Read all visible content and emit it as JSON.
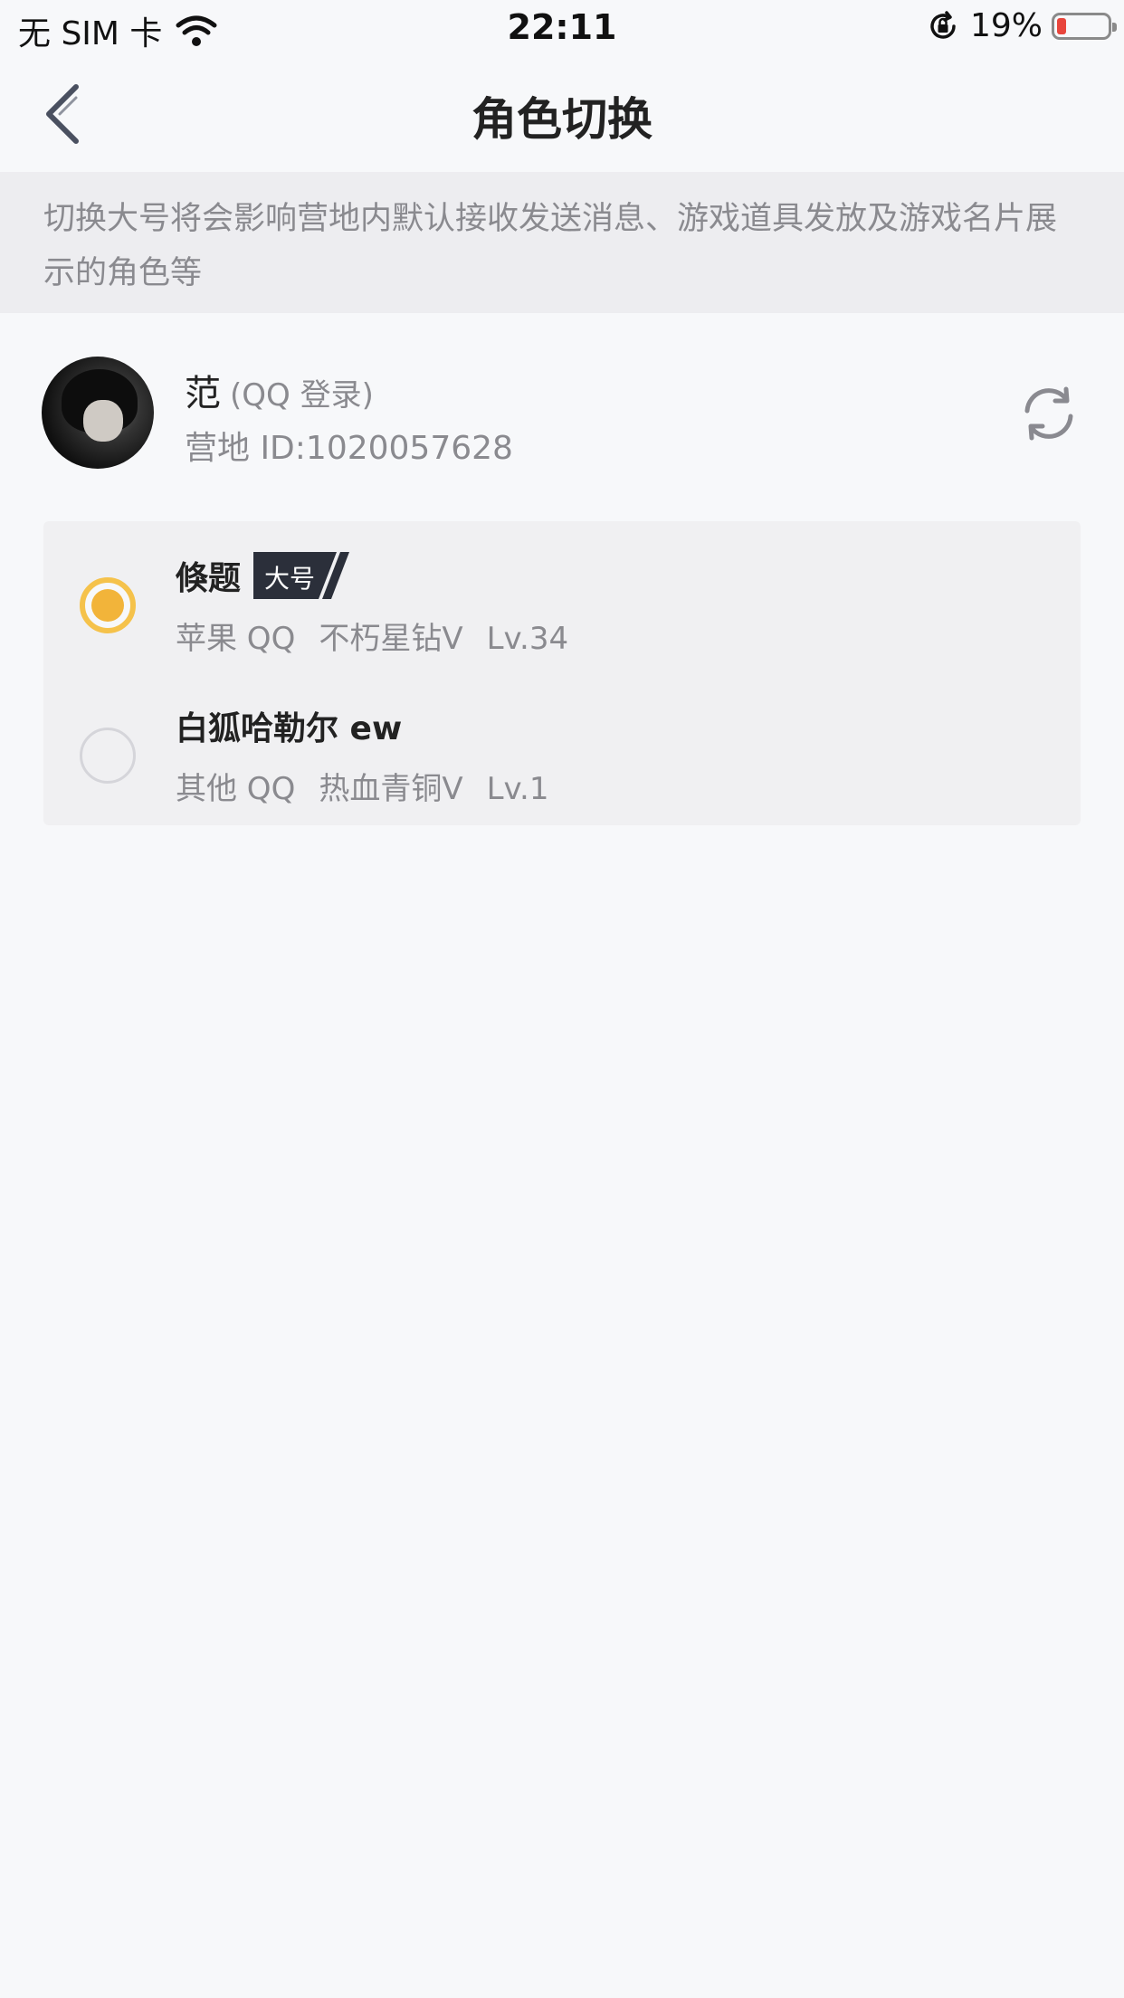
{
  "status_bar": {
    "carrier": "无 SIM 卡",
    "time": "22:11",
    "battery_percent": "19%",
    "battery_level": 0.19,
    "battery_color": "#e8453c"
  },
  "nav": {
    "title": "角色切换",
    "back_icon": "chevron-left-icon"
  },
  "notice": {
    "text": "切换大号将会影响营地内默认接收发送消息、游戏道具发放及游戏名片展示的角色等"
  },
  "profile": {
    "name": "范",
    "login_type": "(QQ 登录)",
    "camp_id": "营地 ID:1020057628",
    "refresh_icon": "refresh-icon"
  },
  "roles": [
    {
      "name": "倏题",
      "badge": "大号",
      "platform": "苹果 QQ",
      "rank": "不朽星钻Ⅴ",
      "level": "Lv.34",
      "selected": true
    },
    {
      "name": "白狐哈勒尔 ew",
      "badge": "",
      "platform": "其他 QQ",
      "rank": "热血青铜Ⅴ",
      "level": "Lv.1",
      "selected": false
    }
  ],
  "colors": {
    "accent": "#f2b43a",
    "badge_bg": "#2b2f3a",
    "muted_text": "#8a8a8f"
  }
}
